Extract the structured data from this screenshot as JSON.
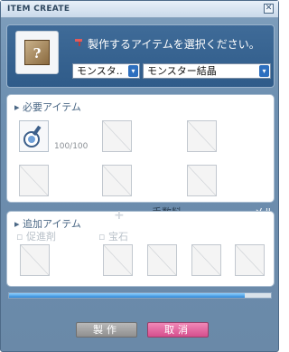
{
  "window": {
    "title": "ITEM CREATE",
    "close_glyph": "✕"
  },
  "top": {
    "prompt": "製作するアイテムを選択ください。",
    "selectors": [
      {
        "value": "モンスタ..",
        "arrow": "▾"
      },
      {
        "value": "モンスター結晶",
        "arrow": "▾"
      }
    ],
    "item_glyph": "?"
  },
  "required": {
    "title": "必要アイテム",
    "first_qty": "100/100"
  },
  "additional": {
    "title": "追加アイテム",
    "fee_label": "手数料",
    "mesos_label": "メル",
    "catalyst_label": "促進剤",
    "gem_label": "宝石"
  },
  "progress": {
    "percent": 90
  },
  "buttons": {
    "make": "製作",
    "cancel": "取消"
  },
  "icons": {
    "close": "close-icon",
    "hammer": "hammer-icon",
    "selector": "chevron-down-icon",
    "required_item": "potion-icon"
  },
  "colors": {
    "accent": "#2d6fbf",
    "cancel": "#d64f8e",
    "panel": "#2f5b89"
  }
}
